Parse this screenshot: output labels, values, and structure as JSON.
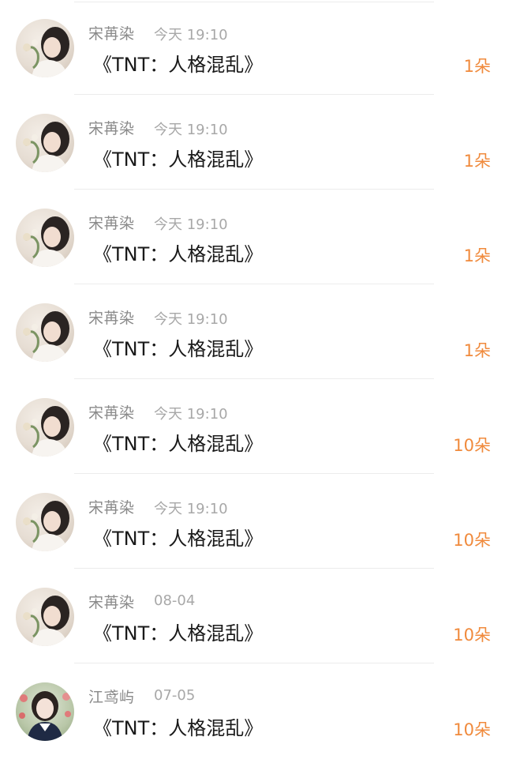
{
  "gifts": [
    {
      "user": "宋苒染",
      "time": "今天 19:10",
      "title": "《TNT：人格混乱》",
      "count": "1朵",
      "avatar": "avatar-girl-flowers"
    },
    {
      "user": "宋苒染",
      "time": "今天 19:10",
      "title": "《TNT：人格混乱》",
      "count": "1朵",
      "avatar": "avatar-girl-flowers"
    },
    {
      "user": "宋苒染",
      "time": "今天 19:10",
      "title": "《TNT：人格混乱》",
      "count": "1朵",
      "avatar": "avatar-girl-flowers"
    },
    {
      "user": "宋苒染",
      "time": "今天 19:10",
      "title": "《TNT：人格混乱》",
      "count": "1朵",
      "avatar": "avatar-girl-flowers"
    },
    {
      "user": "宋苒染",
      "time": "今天 19:10",
      "title": "《TNT：人格混乱》",
      "count": "10朵",
      "avatar": "avatar-girl-flowers"
    },
    {
      "user": "宋苒染",
      "time": "今天 19:10",
      "title": "《TNT：人格混乱》",
      "count": "10朵",
      "avatar": "avatar-girl-flowers"
    },
    {
      "user": "宋苒染",
      "time": "08-04",
      "title": "《TNT：人格混乱》",
      "count": "10朵",
      "avatar": "avatar-girl-flowers"
    },
    {
      "user": "江鸢屿",
      "time": "07-05",
      "title": "《TNT：人格混乱》",
      "count": "10朵",
      "avatar": "avatar-girl-tulips"
    }
  ],
  "colors": {
    "accent": "#f08a3c",
    "name": "#8a8a8a",
    "time": "#a8a8a8",
    "title": "#1a1a1a"
  }
}
